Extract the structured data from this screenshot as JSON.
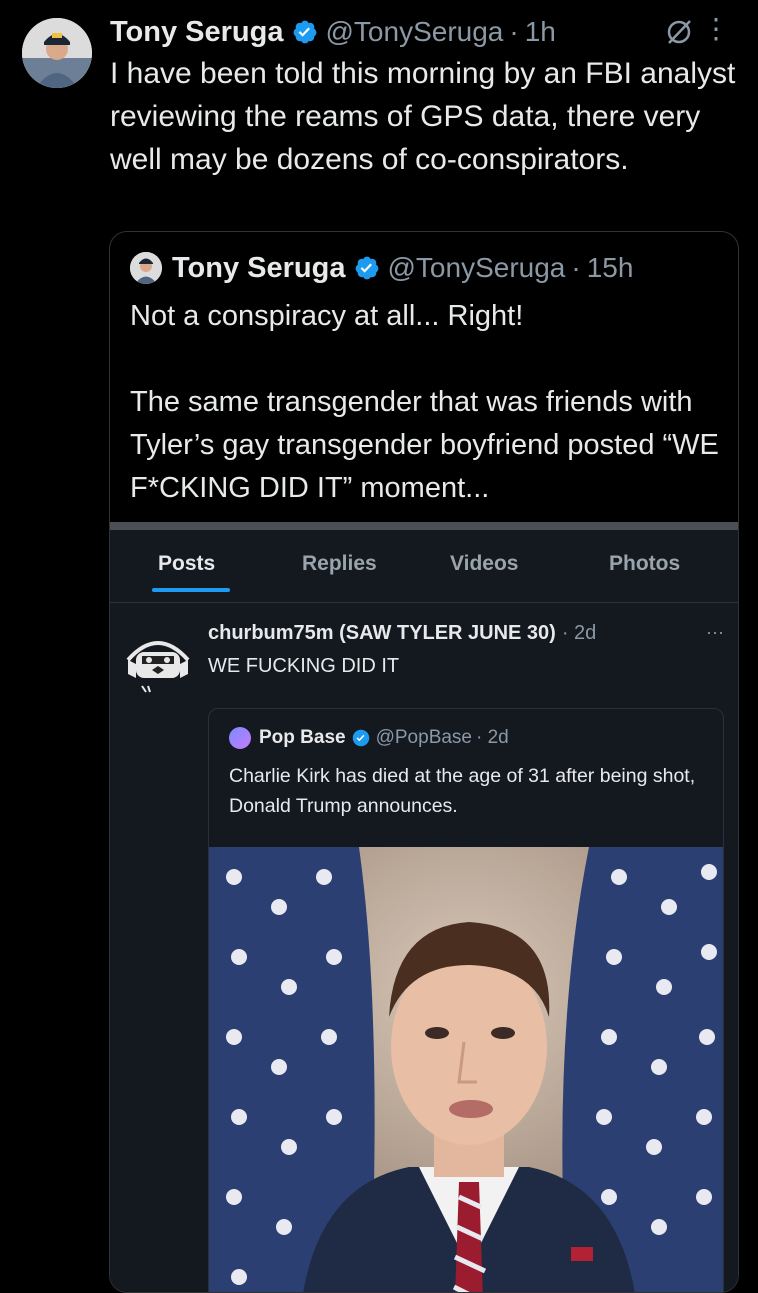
{
  "tweet": {
    "author_name": "Tony Seruga",
    "handle": "@TonySeruga",
    "time": "1h",
    "separator": "·",
    "text": "I have been told this morning by an FBI analyst reviewing the reams of GPS data, there very well may be dozens of co-conspirators."
  },
  "quote": {
    "author_name": "Tony Seruga",
    "handle": "@TonySeruga",
    "time": "15h",
    "separator": "·",
    "line1": "Not a conspiracy at all... Right!",
    "line2": "The same transgender that was friends with Tyler’s gay transgender boyfriend posted “WE F*CKING DID IT” moment..."
  },
  "embed": {
    "tabs": [
      "Posts",
      "Replies",
      "Videos",
      "Photos"
    ],
    "active_tab": "Posts",
    "post": {
      "author_name": "churbum75m (SAW TYLER JUNE 30)",
      "meta": "· 2d",
      "more": "···",
      "text": "WE FUCKING DID IT"
    },
    "quoted": {
      "author_name": "Pop Base",
      "handle": "@PopBase",
      "meta": "· 2d",
      "text": "Charlie Kirk has died at the age of 31 after being shot, Donald Trump announces."
    }
  },
  "icons": {
    "verified": "verified-badge-icon",
    "grok": "grok-icon",
    "more": "more-options-icon"
  },
  "colors": {
    "background": "#000000",
    "text": "#e7e9ea",
    "muted": "#8b98a5",
    "accent": "#1d9bf0",
    "border": "#2f3336"
  }
}
